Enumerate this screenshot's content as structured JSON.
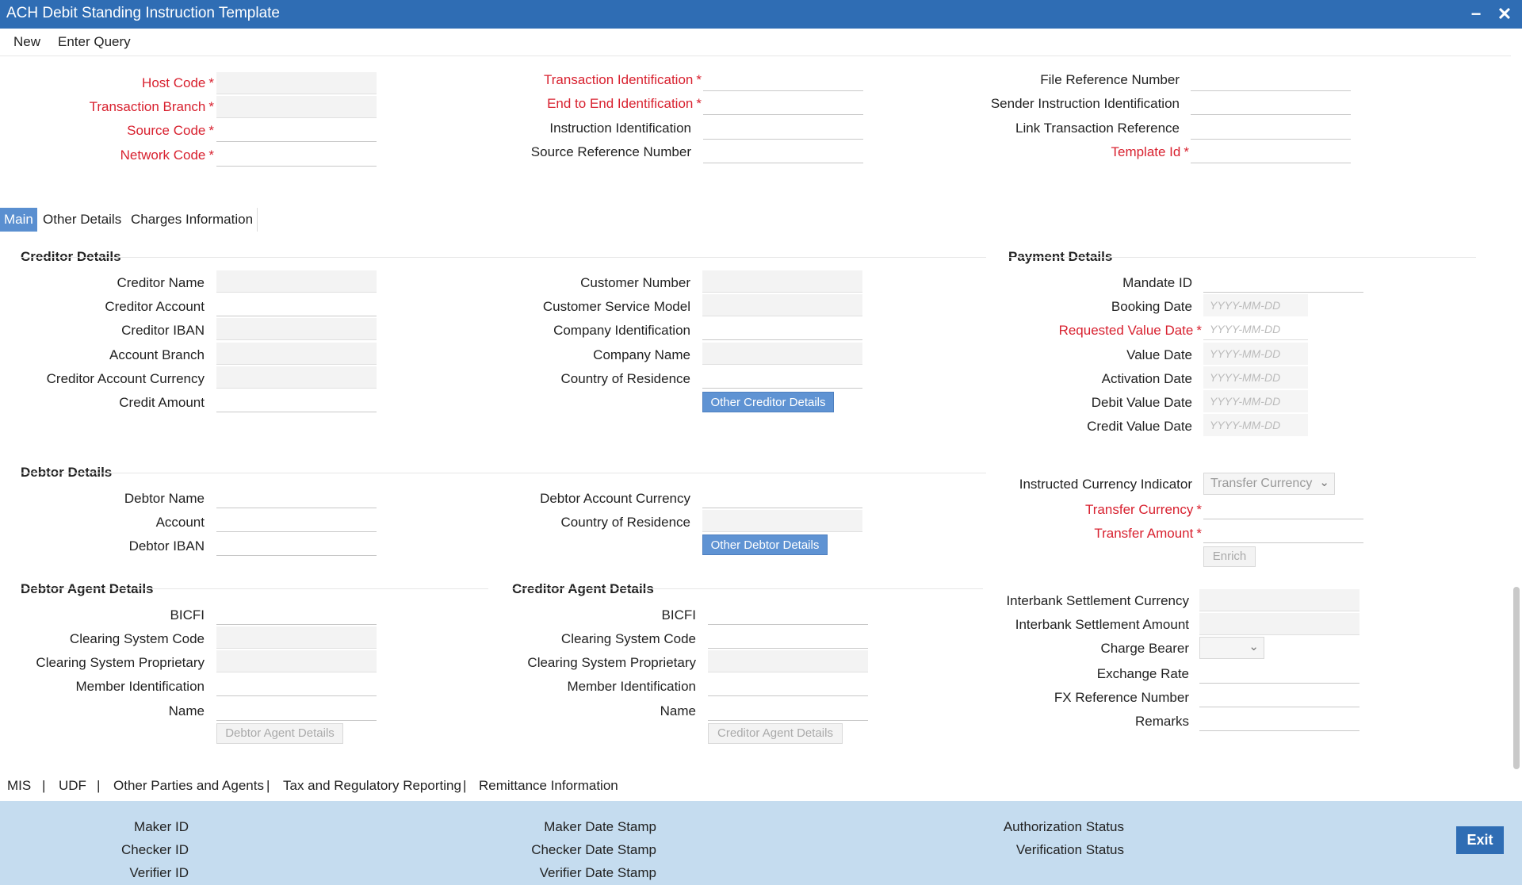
{
  "window": {
    "title": "ACH Debit Standing Instruction Template",
    "minimize": "−",
    "close": "✕"
  },
  "menu": {
    "new": "New",
    "enter_query": "Enter Query"
  },
  "header": {
    "host_code": "Host Code",
    "transaction_branch": "Transaction Branch",
    "source_code": "Source Code",
    "network_code": "Network Code",
    "transaction_identification": "Transaction Identification",
    "end_to_end_identification": "End to End Identification",
    "instruction_identification": "Instruction Identification",
    "source_reference_number": "Source Reference Number",
    "file_reference_number": "File Reference Number",
    "sender_instruction_identification": "Sender Instruction Identification",
    "link_transaction_reference": "Link Transaction Reference",
    "template_id": "Template Id",
    "required_mark": "*"
  },
  "tabs": [
    "Main",
    "Other Details",
    "Charges Information"
  ],
  "creditor": {
    "section": "Creditor Details",
    "creditor_name": "Creditor Name",
    "creditor_account": "Creditor Account",
    "creditor_iban": "Creditor IBAN",
    "account_branch": "Account Branch",
    "creditor_account_currency": "Creditor Account Currency",
    "credit_amount": "Credit Amount",
    "customer_number": "Customer Number",
    "customer_service_model": "Customer Service Model",
    "company_identification": "Company Identification",
    "company_name": "Company Name",
    "country_of_residence": "Country of Residence",
    "other_button": "Other Creditor Details"
  },
  "payment": {
    "section": "Payment Details",
    "mandate_id": "Mandate ID",
    "booking_date": "Booking Date",
    "requested_value_date": "Requested Value Date",
    "value_date": "Value Date",
    "activation_date": "Activation Date",
    "debit_value_date": "Debit Value Date",
    "credit_value_date": "Credit Value Date",
    "date_placeholder": "YYYY-MM-DD",
    "instructed_currency_indicator": "Instructed Currency Indicator",
    "instructed_currency_value": "Transfer Currency",
    "transfer_currency": "Transfer Currency",
    "transfer_amount": "Transfer Amount",
    "enrich_button": "Enrich",
    "interbank_settlement_currency": "Interbank Settlement Currency",
    "interbank_settlement_amount": "Interbank Settlement Amount",
    "charge_bearer": "Charge Bearer",
    "exchange_rate": "Exchange Rate",
    "fx_reference_number": "FX Reference Number",
    "remarks": "Remarks"
  },
  "debtor": {
    "section": "Debtor Details",
    "debtor_name": "Debtor Name",
    "account": "Account",
    "debtor_iban": "Debtor IBAN",
    "debtor_account_currency": "Debtor Account Currency",
    "country_of_residence": "Country of Residence",
    "other_button": "Other Debtor Details"
  },
  "debtor_agent": {
    "section": "Debtor Agent Details",
    "bicfi": "BICFI",
    "clearing_system_code": "Clearing System Code",
    "clearing_system_proprietary": "Clearing System Proprietary",
    "member_identification": "Member Identification",
    "name": "Name",
    "button": "Debtor Agent Details"
  },
  "creditor_agent": {
    "section": "Creditor Agent Details",
    "bicfi": "BICFI",
    "clearing_system_code": "Clearing System Code",
    "clearing_system_proprietary": "Clearing System Proprietary",
    "member_identification": "Member Identification",
    "name": "Name",
    "button": "Creditor Agent Details"
  },
  "bottom_links": [
    "MIS",
    "UDF",
    "Other Parties and Agents",
    "Tax and Regulatory Reporting",
    "Remittance Information"
  ],
  "separator": "|",
  "footer": {
    "maker_id": "Maker ID",
    "checker_id": "Checker ID",
    "verifier_id": "Verifier ID",
    "maker_date_stamp": "Maker Date Stamp",
    "checker_date_stamp": "Checker Date Stamp",
    "verifier_date_stamp": "Verifier Date Stamp",
    "authorization_status": "Authorization Status",
    "verification_status": "Verification Status",
    "exit": "Exit"
  },
  "chevron": "⌄"
}
